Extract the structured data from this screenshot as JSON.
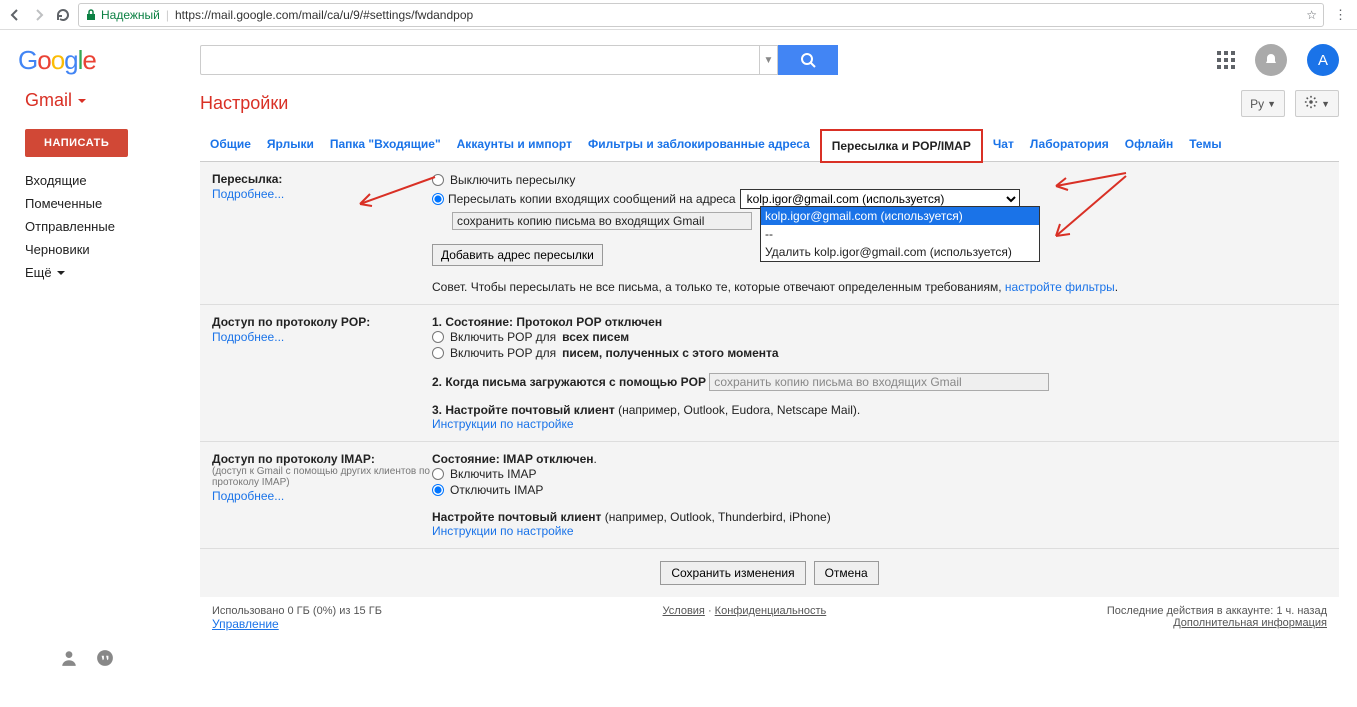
{
  "browser": {
    "url": "https://mail.google.com/mail/ca/u/9/#settings/fwdandpop",
    "secure_label": "Надежный"
  },
  "header": {
    "logo": "Google",
    "avatar_letter": "A"
  },
  "sidebar": {
    "brand": "Gmail",
    "compose": "НАПИСАТЬ",
    "items": [
      "Входящие",
      "Помеченные",
      "Отправленные",
      "Черновики"
    ],
    "more": "Ещё"
  },
  "page_title": "Настройки",
  "lang_btn": "Ру",
  "tabs": [
    "Общие",
    "Ярлыки",
    "Папка \"Входящие\"",
    "Аккаунты и импорт",
    "Фильтры и заблокированные адреса",
    "Пересылка и POP/IMAP",
    "Чат",
    "Лаборатория",
    "Офлайн",
    "Темы"
  ],
  "forwarding": {
    "label": "Пересылка:",
    "more": "Подробнее...",
    "opt_disable": "Выключить пересылку",
    "opt_forward": "Пересылать копии входящих сообщений на адреса",
    "selected_address": "kolp.igor@gmail.com (используется)",
    "keep_copy": "сохранить копию письма во входящих Gmail",
    "dropdown": [
      "kolp.igor@gmail.com (используется)",
      "--",
      "Удалить kolp.igor@gmail.com (используется)"
    ],
    "add_btn": "Добавить адрес пересылки",
    "tip_pre": "Совет. Чтобы пересылать не все письма, а только те, которые отвечают определенным требованиям, ",
    "tip_link": "настройте фильтры",
    "tip_post": "."
  },
  "pop": {
    "label": "Доступ по протоколу POP:",
    "more": "Подробнее...",
    "s1_bold": "1. Состояние: Протокол POP отключен",
    "r1_pre": "Включить POP для ",
    "r1_bold": "всех писем",
    "r2_pre": "Включить POP для ",
    "r2_bold": "писем, полученных с этого момента",
    "s2_bold": "2. Когда письма загружаются с помощью POP",
    "s2_select": "сохранить копию письма во входящих Gmail",
    "s3_bold": "3. Настройте почтовый клиент ",
    "s3_rest": "(например, Outlook, Eudora, Netscape Mail).",
    "s3_link": "Инструкции по настройке"
  },
  "imap": {
    "label": "Доступ по протоколу IMAP:",
    "sub": "(доступ к Gmail с помощью других клиентов по протоколу IMAP)",
    "more": "Подробнее...",
    "state_b": "Состояние: ",
    "state_v": "IMAP отключен",
    "r1": "Включить IMAP",
    "r2": "Отключить IMAP",
    "conf_b": "Настройте почтовый клиент ",
    "conf_rest": "(например, Outlook, Thunderbird, iPhone)",
    "link": "Инструкции по настройке"
  },
  "buttons": {
    "save": "Сохранить изменения",
    "cancel": "Отмена"
  },
  "footer": {
    "storage": "Использовано 0 ГБ (0%) из 15 ГБ",
    "manage": "Управление",
    "terms": "Условия",
    "privacy": "Конфиденциальность",
    "activity": "Последние действия в аккаунте: 1 ч. назад",
    "details": "Дополнительная информация"
  }
}
